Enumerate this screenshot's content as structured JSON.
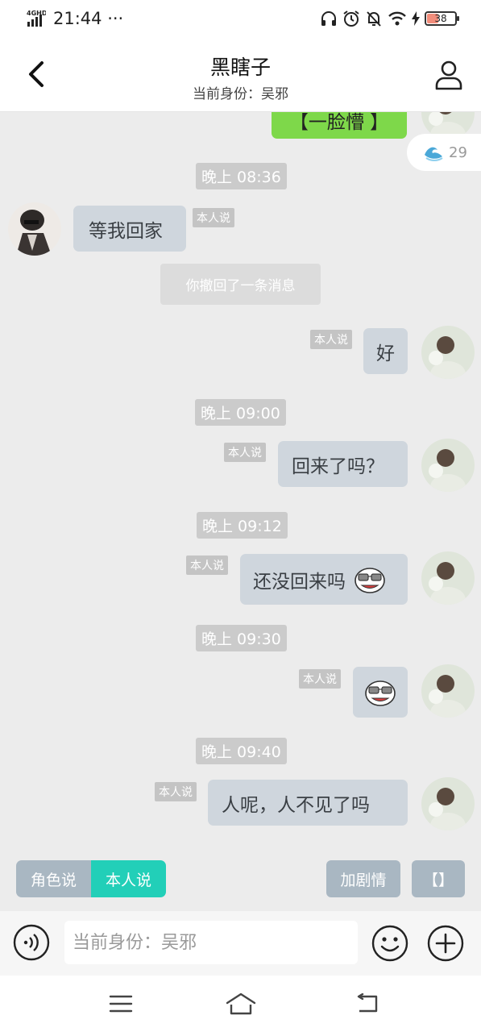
{
  "status_bar": {
    "network": "4GHD",
    "time": "21:44 ···",
    "battery": "38"
  },
  "header": {
    "title": "黑瞎子",
    "subtitle": "当前身份：吴邪"
  },
  "chat": {
    "partial_sticker_text": "【一脸懵 】",
    "float_badge_count": "29",
    "messages": [
      {
        "time": "晚上 08:36"
      },
      {
        "tag": "本人说",
        "text": "等我回家"
      },
      {
        "recall": "你撤回了一条消息"
      },
      {
        "tag": "本人说",
        "text": "好"
      },
      {
        "time": "晚上 09:00"
      },
      {
        "tag": "本人说",
        "text": "回来了吗？"
      },
      {
        "time": "晚上 09:12"
      },
      {
        "tag": "本人说",
        "text": "还没回来吗"
      },
      {
        "time": "晚上 09:30"
      },
      {
        "tag": "本人说",
        "sticker": "glasses-face-sticker"
      },
      {
        "time": "晚上 09:40"
      },
      {
        "tag": "本人说",
        "text": "人呢，人不见了吗"
      }
    ]
  },
  "controls": {
    "role_say": "角色说",
    "self_say": "本人说",
    "add_plot": "加剧情",
    "brackets": "【】"
  },
  "input": {
    "placeholder": "当前身份：吴邪"
  },
  "colors": {
    "accent": "#22cfb8",
    "bubble": "#cfd6dd",
    "sent_green": "#7ed84a",
    "background": "#ececec"
  },
  "icons": [
    "back-icon",
    "profile-icon",
    "voice-icon",
    "emoji-icon",
    "plus-icon",
    "menu-icon",
    "home-icon",
    "return-icon",
    "wave-icon"
  ]
}
